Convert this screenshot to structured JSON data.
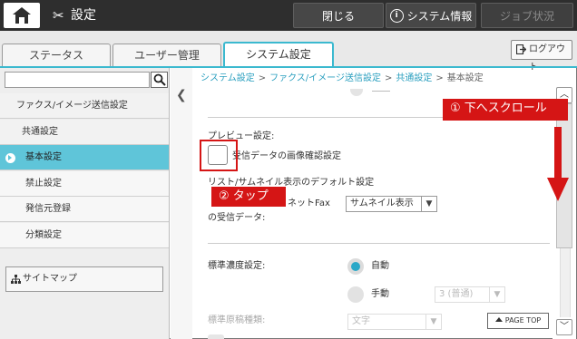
{
  "topbar": {
    "title": "設定",
    "close_label": "閉じる",
    "system_info_label": "システム情報",
    "job_status_label": "ジョブ状況"
  },
  "tabs": [
    {
      "label": "ステータス"
    },
    {
      "label": "ユーザー管理"
    },
    {
      "label": "システム設定"
    }
  ],
  "logout_label": "ログアウト",
  "search": {
    "value": "",
    "placeholder": ""
  },
  "sidebar": {
    "items": [
      {
        "label": "ファクス/イメージ送信設定"
      },
      {
        "label": "共通設定"
      },
      {
        "label": "基本設定"
      },
      {
        "label": "禁止設定"
      },
      {
        "label": "発信元登録"
      },
      {
        "label": "分類設定"
      }
    ],
    "sitemap_label": "サイトマップ"
  },
  "breadcrumb": [
    {
      "label": "システム設定"
    },
    {
      "label": "ファクス/イメージ送信設定"
    },
    {
      "label": "共通設定"
    },
    {
      "label": "基本設定"
    }
  ],
  "settings": {
    "preview_heading": "プレビュー設定:",
    "preview_checkbox_label": "受信データの画像確認設定",
    "thumbnail_heading": "リスト/サムネイル表示のデフォルト設定",
    "thumbnail_sub": "ネットFax",
    "thumbnail_sub2": "の受信データ:",
    "thumbnail_select": "サムネイル表示",
    "density_heading": "標準濃度設定:",
    "density_auto": "自動",
    "density_manual": "手動",
    "density_select": "3 (普通)",
    "original_type_heading": "標準原稿種類:",
    "original_type_select": "文字"
  },
  "page_top_label": "PAGE TOP",
  "annotations": {
    "scroll_down": "① 下へスクロール",
    "tap": "② タップ"
  },
  "colors": {
    "accent": "#3bb9cf",
    "active_nav": "#5fc5d9",
    "annotation": "#d51515",
    "topbar": "#2e2e2e"
  }
}
